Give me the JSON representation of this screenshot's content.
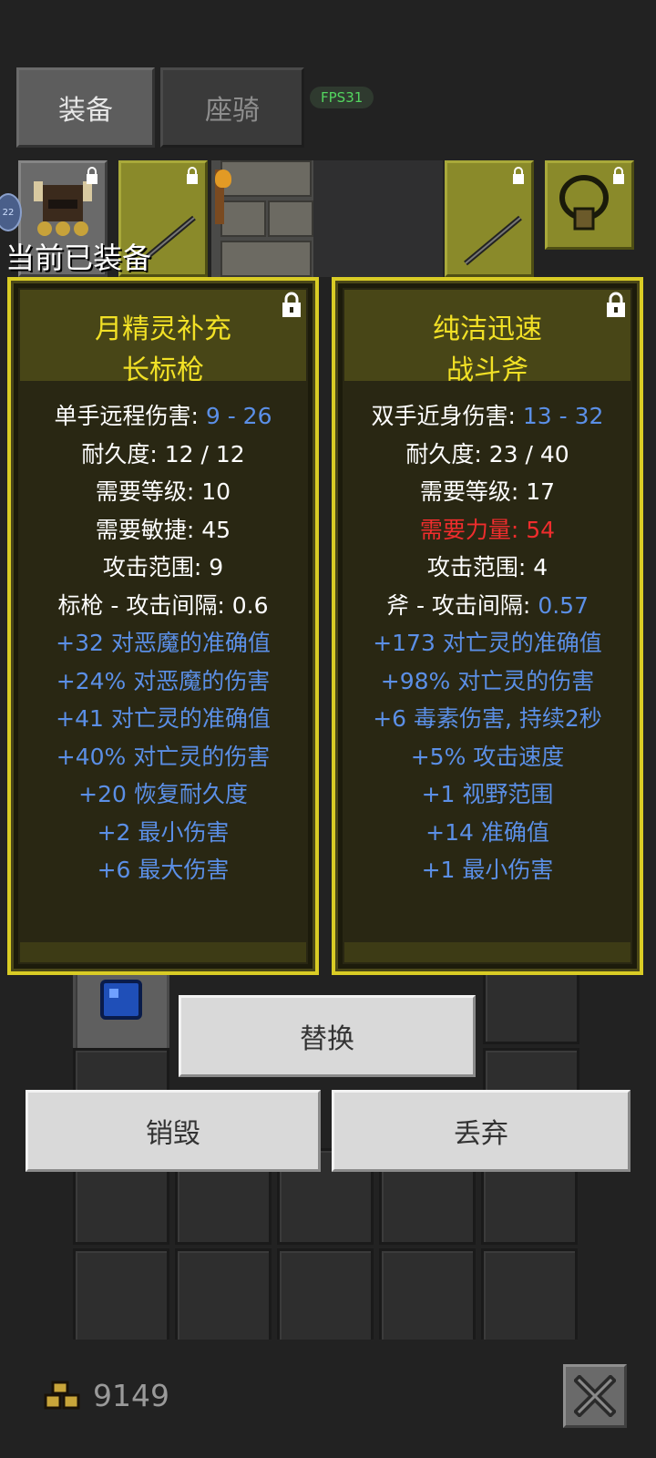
{
  "tabs": [
    {
      "label": "装备",
      "active": true
    },
    {
      "label": "座骑",
      "active": false
    }
  ],
  "fps": "FPS31",
  "equipped_label": "当前已装备",
  "avatar_level": "22",
  "cards": [
    {
      "name_line1": "月精灵补充",
      "name_line2": "长标枪",
      "locked": true,
      "stats": [
        {
          "label": "单手远程伤害: ",
          "value": "9 - 26",
          "style": "mixed"
        },
        {
          "text": "耐久度: 12 / 12",
          "style": "white"
        },
        {
          "text": "需要等级: 10",
          "style": "white"
        },
        {
          "text": "需要敏捷: 45",
          "style": "white"
        },
        {
          "text": "攻击范围: 9",
          "style": "white"
        },
        {
          "text": "标枪 - 攻击间隔: 0.6",
          "style": "white"
        },
        {
          "text": "+32 对恶魔的准确值",
          "style": "blue"
        },
        {
          "text": "+24% 对恶魔的伤害",
          "style": "blue"
        },
        {
          "text": "+41 对亡灵的准确值",
          "style": "blue"
        },
        {
          "text": "+40% 对亡灵的伤害",
          "style": "blue"
        },
        {
          "text": "+20 恢复耐久度",
          "style": "blue"
        },
        {
          "text": "+2 最小伤害",
          "style": "blue"
        },
        {
          "text": "+6 最大伤害",
          "style": "blue"
        }
      ]
    },
    {
      "name_line1": "纯洁迅速",
      "name_line2": "战斗斧",
      "locked": true,
      "stats": [
        {
          "label": "双手近身伤害: ",
          "value": "13 - 32",
          "style": "mixed"
        },
        {
          "text": "耐久度: 23 / 40",
          "style": "white"
        },
        {
          "text": "需要等级: 17",
          "style": "white"
        },
        {
          "text": "需要力量: 54",
          "style": "red"
        },
        {
          "text": "攻击范围: 4",
          "style": "white"
        },
        {
          "label": "斧 - 攻击间隔: ",
          "value": "0.57",
          "style": "mixed"
        },
        {
          "text": "+173 对亡灵的准确值",
          "style": "blue"
        },
        {
          "text": "+98% 对亡灵的伤害",
          "style": "blue"
        },
        {
          "text": "+6 毒素伤害, 持续2秒",
          "style": "blue"
        },
        {
          "text": "+5% 攻击速度",
          "style": "blue"
        },
        {
          "text": "+1 视野范围",
          "style": "blue"
        },
        {
          "text": "+14 准确值",
          "style": "blue"
        },
        {
          "text": "+1 最小伤害",
          "style": "blue"
        }
      ]
    }
  ],
  "buttons": {
    "replace": "替换",
    "destroy": "销毁",
    "drop": "丢弃"
  },
  "gold": "9149",
  "colors": {
    "card_border": "#d9cc25",
    "title": "#f2e126",
    "bonus": "#5b8fe6",
    "unmet": "#ef2d2d"
  }
}
